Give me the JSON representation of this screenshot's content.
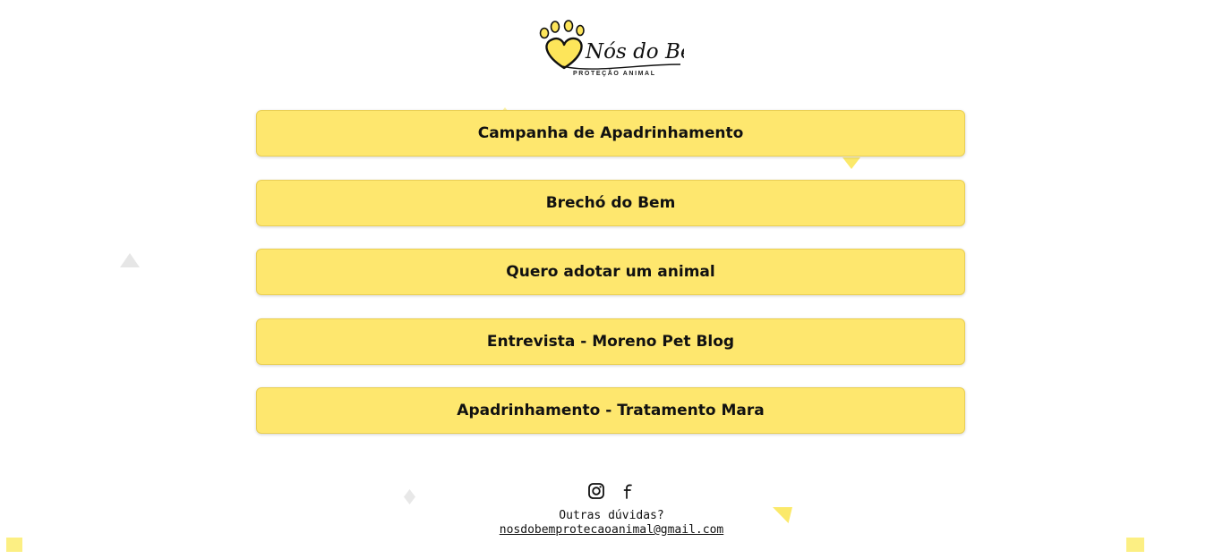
{
  "brand": {
    "name": "Nós do Bem",
    "tagline": "PROTEÇÃO ANIMAL",
    "colors": {
      "button_bg": "#fee76e",
      "button_border": "#e9cf55",
      "accent_yellow": "#fbe96a",
      "text": "#111111"
    }
  },
  "links": [
    {
      "label": "Campanha de Apadrinhamento"
    },
    {
      "label": "Brechó do Bem"
    },
    {
      "label": "Quero adotar um animal"
    },
    {
      "label": "Entrevista - Moreno Pet Blog"
    },
    {
      "label": "Apadrinhamento - Tratamento Mara"
    }
  ],
  "social": {
    "icons": [
      "instagram-icon",
      "facebook-icon"
    ]
  },
  "footer": {
    "question": "Outras dúvidas?",
    "email": "nosdobemprotecaoanimal@gmail.com"
  }
}
